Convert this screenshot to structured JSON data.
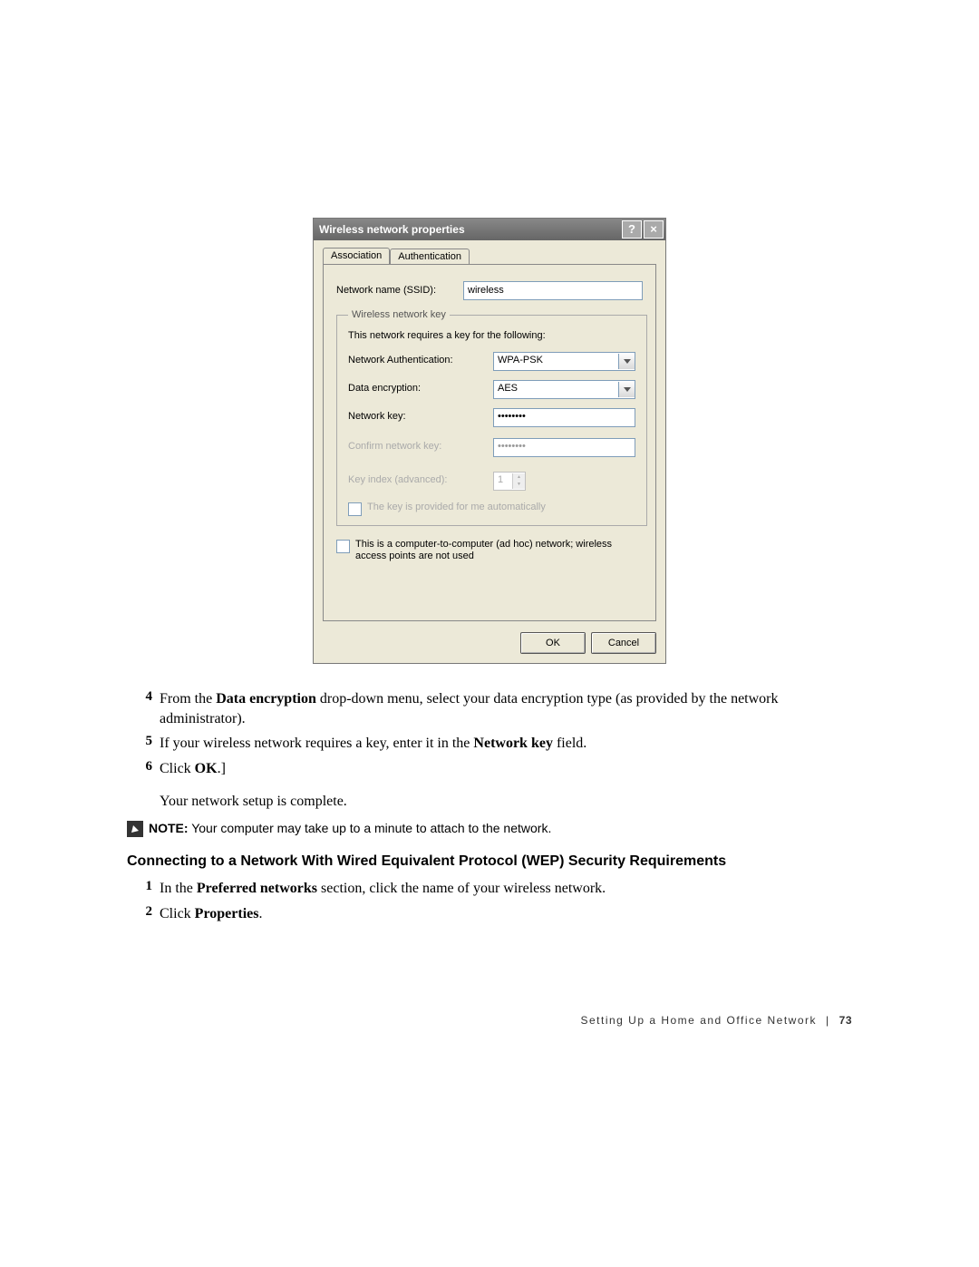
{
  "dialog": {
    "title": "Wireless network properties",
    "help_btn": "?",
    "close_btn": "×",
    "tabs": {
      "association": "Association",
      "authentication": "Authentication"
    },
    "ssid_label": "Network name (SSID):",
    "ssid_value": "wireless",
    "groupbox_label": "Wireless network key",
    "group_intro": "This network requires a key for the following:",
    "auth_label": "Network Authentication:",
    "auth_value": "WPA-PSK",
    "enc_label": "Data encryption:",
    "enc_value": "AES",
    "netkey_label": "Network key:",
    "netkey_value": "••••••••",
    "confirm_label": "Confirm network key:",
    "confirm_value": "••••••••",
    "keyidx_label": "Key index (advanced):",
    "keyidx_value": "1",
    "auto_key_label": "The key is provided for me automatically",
    "adhoc_label": "This is a computer-to-computer (ad hoc) network; wireless access points are not used",
    "ok": "OK",
    "cancel": "Cancel"
  },
  "steps_block1": [
    {
      "num": "4",
      "text_pre": "From the ",
      "bold1": "Data encryption",
      "text_post": " drop-down menu, select your data encryption type (as provided by the network administrator)."
    },
    {
      "num": "5",
      "text_pre": "If your wireless network requires a key, enter it in the ",
      "bold1": "Network key",
      "text_post": " field."
    },
    {
      "num": "6",
      "text_pre": "Click ",
      "bold1": "OK",
      "text_post": ".]"
    }
  ],
  "followup": "Your network setup is complete.",
  "note": {
    "label": "NOTE:",
    "text": " Your computer may take up to a minute to attach to the network."
  },
  "section_title": "Connecting to a Network With Wired Equivalent Protocol (WEP) Security Requirements",
  "steps_block2": [
    {
      "num": "1",
      "text_pre": "In the ",
      "bold1": "Preferred networks",
      "text_post": " section, click the name of your wireless network."
    },
    {
      "num": "2",
      "text_pre": "Click ",
      "bold1": "Properties",
      "text_post": "."
    }
  ],
  "footer": {
    "text": "Setting Up a Home and Office Network",
    "page": "73"
  }
}
